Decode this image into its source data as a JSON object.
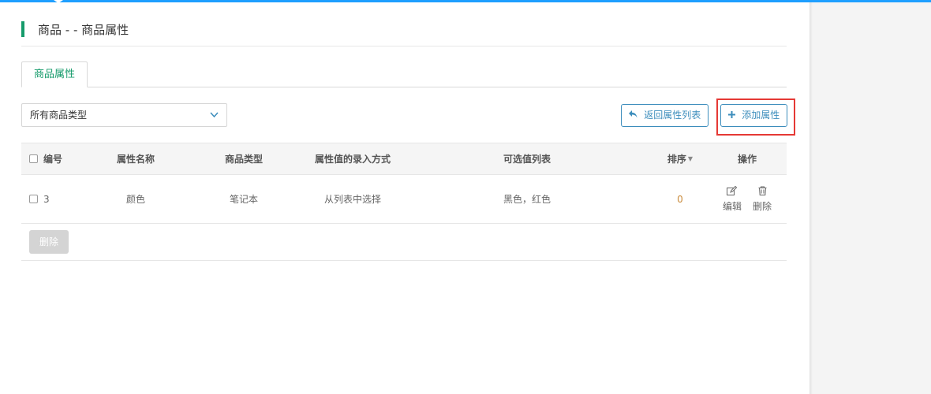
{
  "page": {
    "title": "商品 - - 商品属性",
    "accent_color": "#169b6b",
    "link_color": "#3c8dbc"
  },
  "tabs": [
    {
      "label": "商品属性",
      "active": true
    }
  ],
  "filter": {
    "select_value": "所有商品类型",
    "caret_icon": "chevron-down-icon"
  },
  "actions": {
    "return_label": "返回属性列表",
    "return_icon": "reply-icon",
    "add_label": "添加属性",
    "add_icon": "plus-icon"
  },
  "table": {
    "headers": {
      "id": "编号",
      "name": "属性名称",
      "type": "商品类型",
      "input_mode": "属性值的录入方式",
      "values": "可选值列表",
      "sort": "排序",
      "ops": "操作"
    },
    "rows": [
      {
        "id": "3",
        "name": "颜色",
        "type": "笔记本",
        "input_mode": "从列表中选择",
        "values": "黑色，红色",
        "sort": "0",
        "edit_label": "编辑",
        "delete_label": "删除"
      }
    ]
  },
  "bulk": {
    "delete_label": "删除"
  }
}
